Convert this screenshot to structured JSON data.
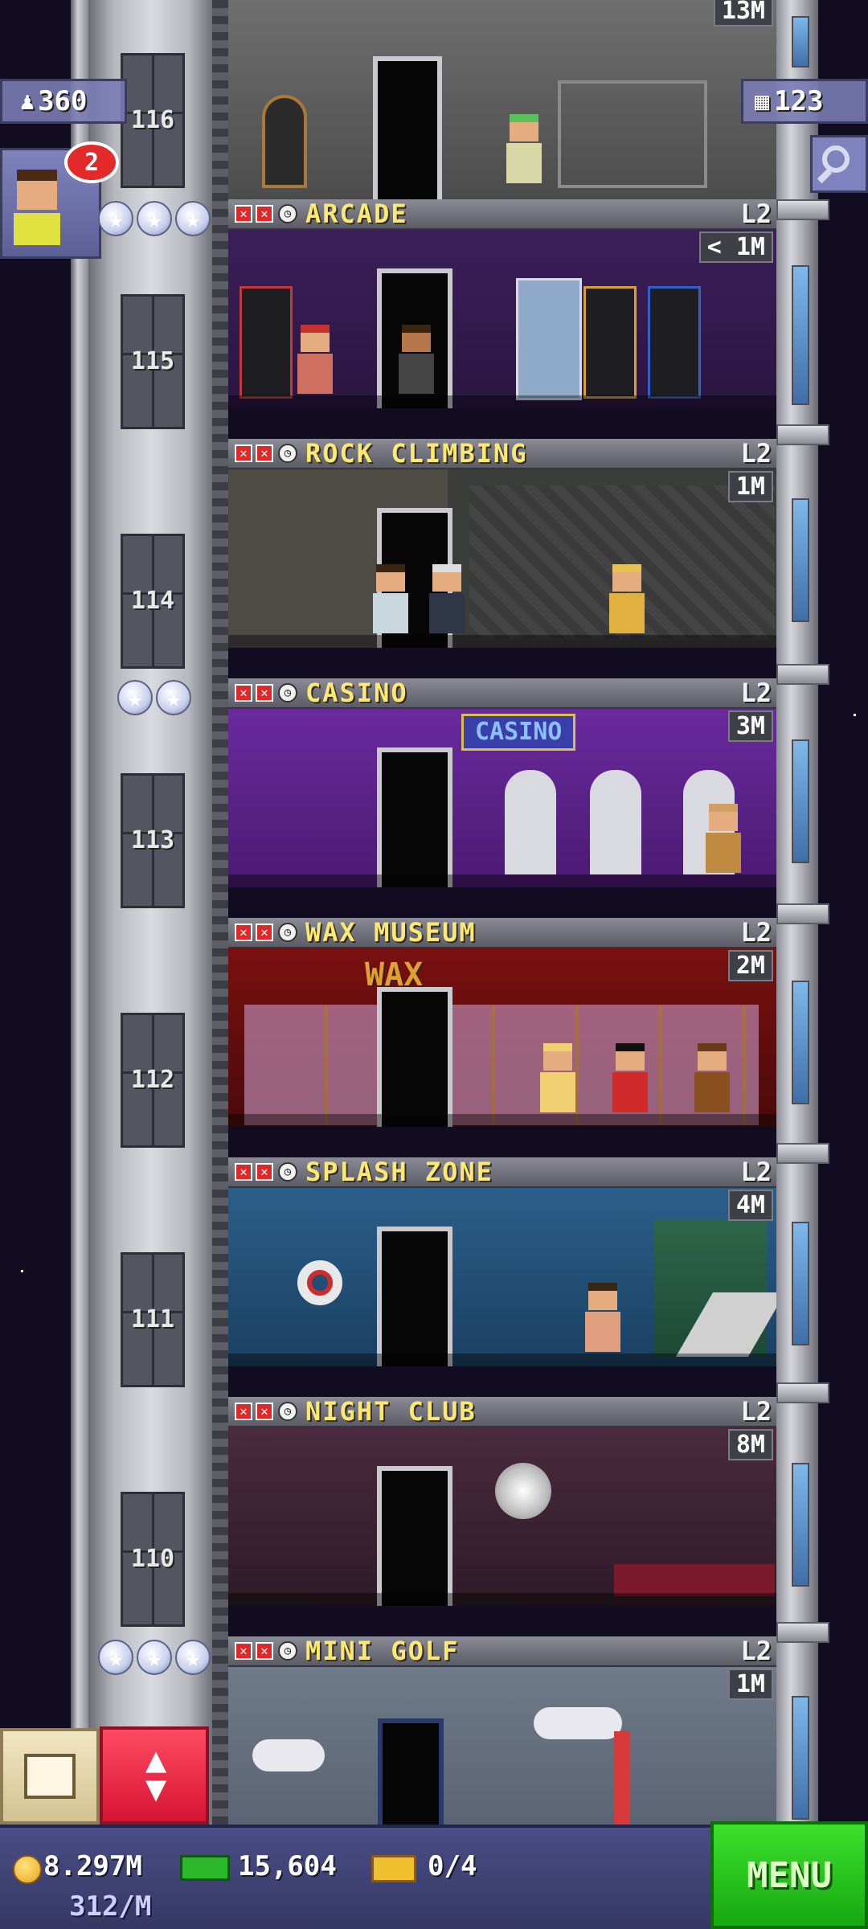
{
  "hud": {
    "population": "360",
    "floors_count": "123",
    "notification_count": "2"
  },
  "top_floor": {
    "number": "116",
    "income": "13M"
  },
  "floors": [
    {
      "name": "ARCADE",
      "level": "L2",
      "income": "< 1M",
      "number": "115",
      "stars": 3
    },
    {
      "name": "ROCK CLIMBING",
      "level": "L2",
      "income": "1M",
      "number": "114",
      "stars": 0
    },
    {
      "name": "CASINO",
      "level": "L2",
      "income": "3M",
      "number": "113",
      "stars": 2
    },
    {
      "name": "WAX MUSEUM",
      "level": "L2",
      "income": "2M",
      "number": "112",
      "stars": 0
    },
    {
      "name": "SPLASH ZONE",
      "level": "L2",
      "income": "4M",
      "number": "111",
      "stars": 0
    },
    {
      "name": "NIGHT CLUB",
      "level": "L2",
      "income": "8M",
      "number": "110",
      "stars": 0
    },
    {
      "name": "MINI GOLF",
      "level": "L2",
      "income": "1M",
      "number": "",
      "stars": 3
    }
  ],
  "signs": {
    "casino": "CASINO",
    "wax": "WAX"
  },
  "bottom": {
    "coins": "8.297M",
    "coins_rate": "312/M",
    "bux": "15,604",
    "tickets": "0/4",
    "menu_label": "MENU"
  },
  "colors": {
    "menu_green": "#2bc81e",
    "elevator_button_red": "#e8203c",
    "title_yellow": "#ffe86e",
    "bar_purple": "#3e4174"
  },
  "icons": [
    "person-icon",
    "grid-icon",
    "magnifier-icon",
    "star-icon",
    "x-icon",
    "clock-icon",
    "crate-icon",
    "elevator-arrows-icon",
    "coin-icon",
    "bux-icon",
    "ticket-icon"
  ]
}
